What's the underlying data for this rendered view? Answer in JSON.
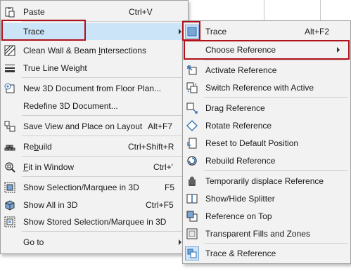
{
  "left_menu": {
    "items": [
      {
        "label": "Paste",
        "shortcut": "Ctrl+V",
        "icon": "clipboard-icon"
      },
      {
        "label": "Trace",
        "shortcut": "",
        "icon": "",
        "submenu": true
      },
      {
        "label": "Clean Wall & Beam Intersections",
        "shortcut": "",
        "icon": "wall-intersection-icon"
      },
      {
        "label": "True Line Weight",
        "shortcut": "",
        "icon": "line-weight-icon"
      },
      {
        "label": "New 3D Document from Floor Plan...",
        "shortcut": "",
        "icon": "new-3d-document-icon"
      },
      {
        "label": "Redefine 3D Document...",
        "shortcut": "",
        "icon": ""
      },
      {
        "label": "Save View and Place on Layout",
        "shortcut": "Alt+F7",
        "icon": "save-view-layout-icon"
      },
      {
        "label": "Rebuild",
        "shortcut": "Ctrl+Shift+R",
        "icon": "rebuild-icon"
      },
      {
        "label": "Fit in Window",
        "shortcut": "Ctrl+'",
        "icon": "zoom-fit-icon"
      },
      {
        "label": "Show Selection/Marquee in 3D",
        "shortcut": "F5",
        "icon": "show-selection-3d-icon"
      },
      {
        "label": "Show All in 3D",
        "shortcut": "Ctrl+F5",
        "icon": "show-all-3d-icon"
      },
      {
        "label": "Show Stored Selection/Marquee in 3D",
        "shortcut": "",
        "icon": "stored-selection-3d-icon"
      },
      {
        "label": "Go to",
        "shortcut": "",
        "icon": "",
        "submenu": true
      }
    ]
  },
  "right_menu": {
    "items": [
      {
        "label": "Trace",
        "shortcut": "Alt+F2",
        "icon": "trace-icon"
      },
      {
        "label": "Choose Reference",
        "shortcut": "",
        "icon": "",
        "submenu": true
      },
      {
        "label": "Activate Reference",
        "shortcut": "",
        "icon": "activate-reference-icon"
      },
      {
        "label": "Switch Reference with Active",
        "shortcut": "",
        "icon": "switch-reference-icon"
      },
      {
        "label": "Drag Reference",
        "shortcut": "",
        "icon": "drag-reference-icon"
      },
      {
        "label": "Rotate Reference",
        "shortcut": "",
        "icon": "rotate-reference-icon"
      },
      {
        "label": "Reset to Default Position",
        "shortcut": "",
        "icon": "reset-position-icon"
      },
      {
        "label": "Rebuild Reference",
        "shortcut": "",
        "icon": "rebuild-reference-icon"
      },
      {
        "label": "Temporarily displace Reference",
        "shortcut": "",
        "icon": "hand-displace-icon"
      },
      {
        "label": "Show/Hide Splitter",
        "shortcut": "",
        "icon": "splitter-icon"
      },
      {
        "label": "Reference on Top",
        "shortcut": "",
        "icon": "reference-on-top-icon"
      },
      {
        "label": "Transparent Fills and Zones",
        "shortcut": "",
        "icon": "transparent-fills-icon"
      },
      {
        "label": "Trace & Reference",
        "shortcut": "",
        "icon": "trace-and-reference-icon"
      }
    ]
  },
  "colors": {
    "highlight": "#cce4f7",
    "annotation_red": "#b0121b",
    "menu_bg": "#f2f2f2",
    "icon_blue": "#2b6cb0"
  }
}
